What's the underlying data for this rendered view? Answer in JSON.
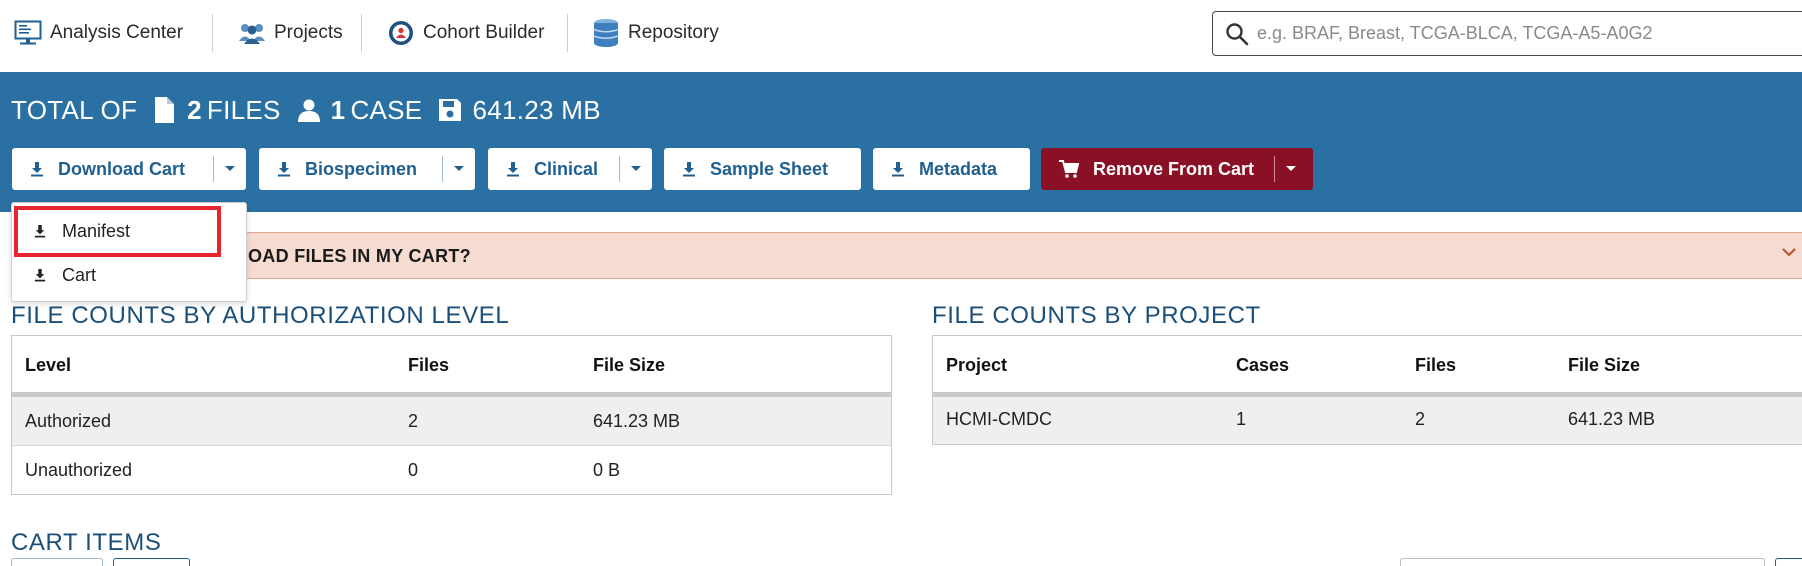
{
  "nav": {
    "analysis_center": "Analysis Center",
    "projects": "Projects",
    "cohort_builder": "Cohort Builder",
    "repository": "Repository",
    "search_placeholder": "e.g. BRAF, Breast, TCGA-BLCA, TCGA-A5-A0G2"
  },
  "summary": {
    "total_of": "TOTAL OF",
    "files_count": "2",
    "files_label": "FILES",
    "cases_count": "1",
    "cases_label": "CASE",
    "size": "641.23 MB"
  },
  "toolbar": {
    "download_cart": "Download Cart",
    "biospecimen": "Biospecimen",
    "clinical": "Clinical",
    "sample_sheet": "Sample Sheet",
    "metadata": "Metadata",
    "remove_from_cart": "Remove From Cart"
  },
  "dropdown": {
    "items": [
      "Manifest",
      "Cart"
    ]
  },
  "alert": {
    "text": "OAD FILES IN MY CART?"
  },
  "auth_table": {
    "title": "FILE COUNTS BY AUTHORIZATION LEVEL",
    "headers": [
      "Level",
      "Files",
      "File Size"
    ],
    "rows": [
      [
        "Authorized",
        "2",
        "641.23 MB"
      ],
      [
        "Unauthorized",
        "0",
        "0 B"
      ]
    ]
  },
  "project_table": {
    "title": "FILE COUNTS BY PROJECT",
    "headers": [
      "Project",
      "Cases",
      "Files",
      "File Size"
    ],
    "rows": [
      [
        "HCMI-CMDC",
        "1",
        "2",
        "641.23 MB"
      ]
    ]
  },
  "cart_items": {
    "title": "CART ITEMS"
  },
  "colors": {
    "band": "#2a70a3",
    "button_text": "#1f5f91",
    "remove_button": "#8a1026",
    "alert_bg": "#f6dbd0",
    "highlight": "#e8252f",
    "section_title": "#1b4f7a"
  }
}
